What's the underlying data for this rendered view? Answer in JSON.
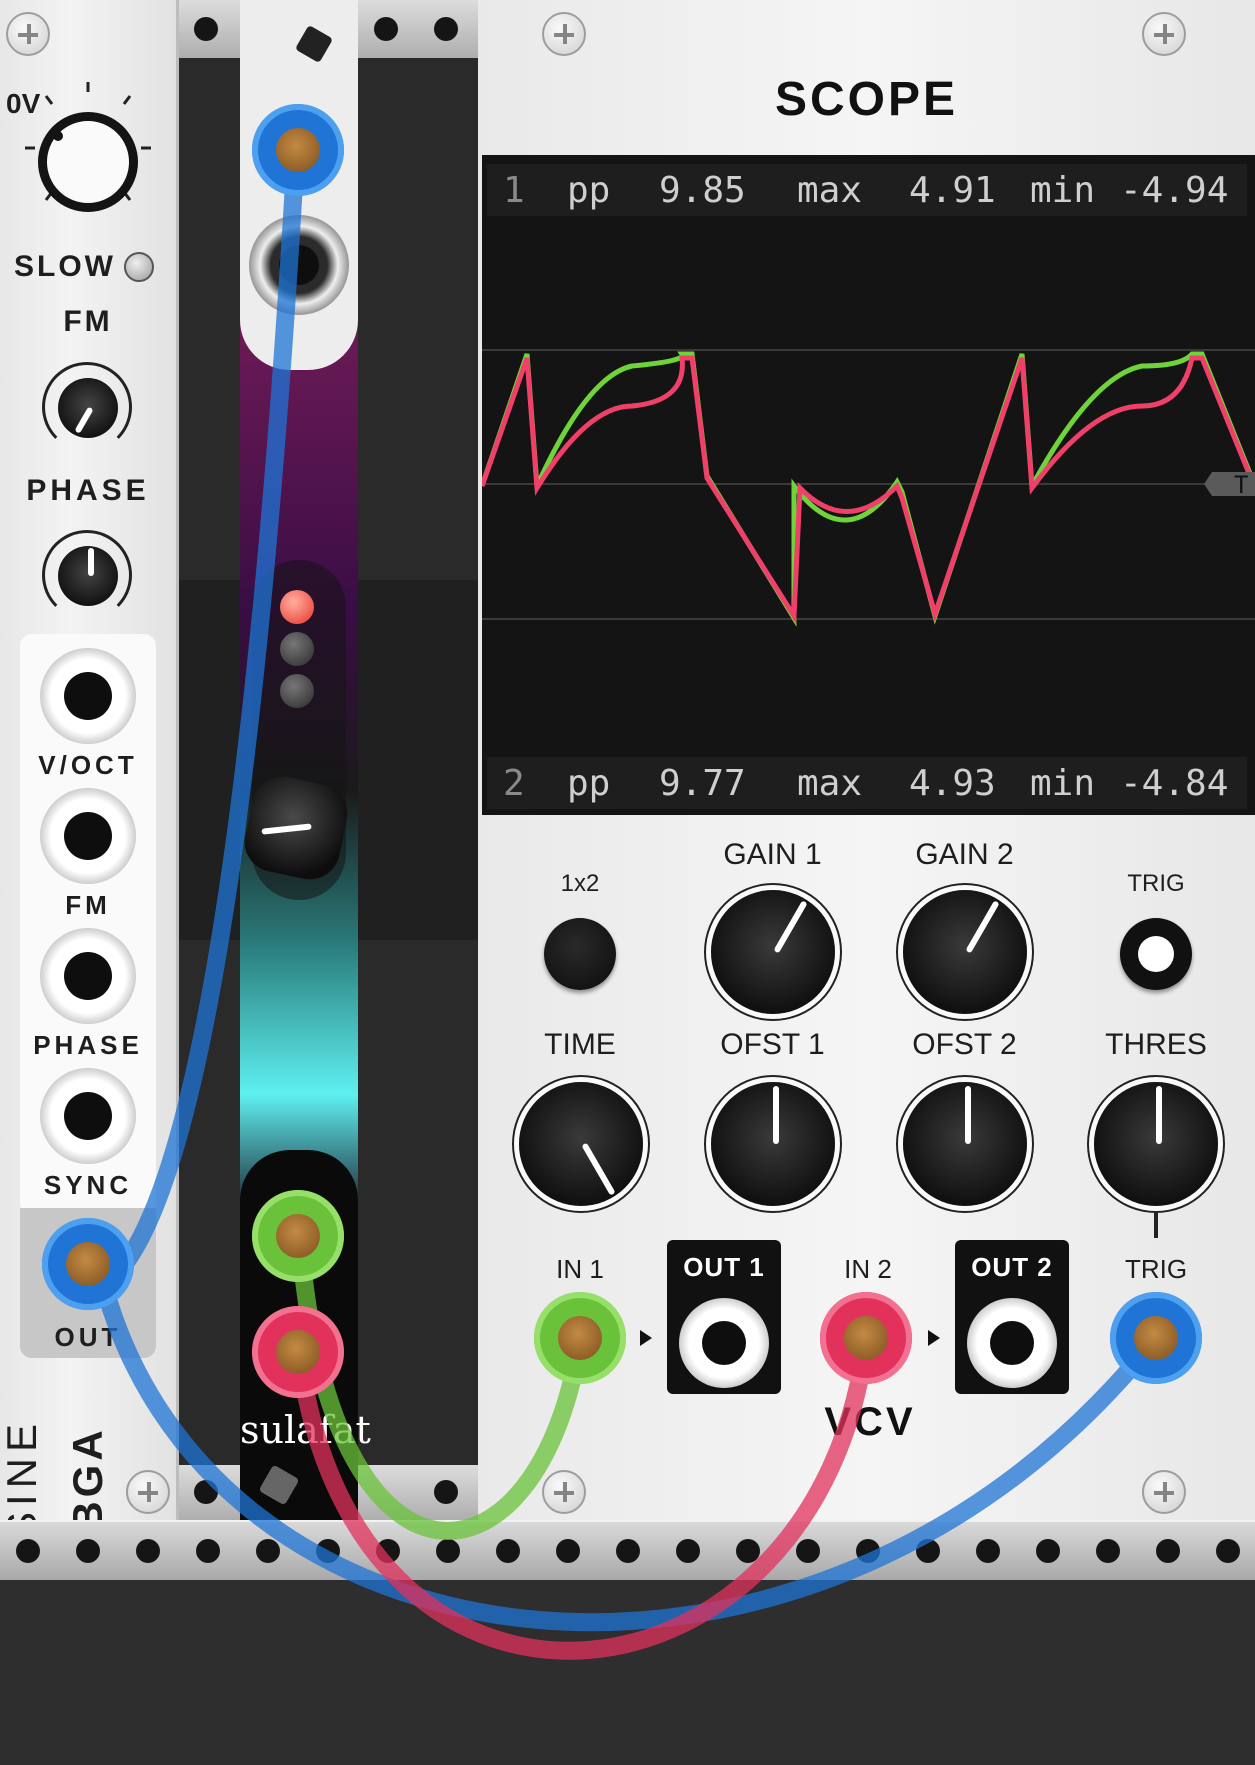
{
  "sine_module": {
    "name": "SINE",
    "brand": "BGA",
    "offset_label": "0V",
    "slow_label": "SLOW",
    "fm_label": "FM",
    "phase_label": "PHASE",
    "inputs": [
      "V/OCT",
      "FM",
      "PHASE",
      "SYNC"
    ],
    "output_label": "OUT"
  },
  "sulafat_module": {
    "name": "sulafat"
  },
  "scope_module": {
    "title": "SCOPE",
    "channel1": {
      "id": "1",
      "pp_label": "pp",
      "pp": "9.85",
      "max_label": "max",
      "max": "4.91",
      "min_label": "min",
      "min": "-4.94"
    },
    "channel2": {
      "id": "2",
      "pp_label": "pp",
      "pp": "9.77",
      "max_label": "max",
      "max": "4.93",
      "min_label": "min",
      "min": "-4.84"
    },
    "trigger_marker": "T",
    "controls": {
      "mode_label": "1x2",
      "gain1_label": "GAIN 1",
      "gain2_label": "GAIN 2",
      "trig_label": "TRIG",
      "time_label": "TIME",
      "ofst1_label": "OFST 1",
      "ofst2_label": "OFST 2",
      "thres_label": "THRES"
    },
    "ports": {
      "in1_label": "IN 1",
      "out1_label": "OUT 1",
      "in2_label": "IN 2",
      "out2_label": "OUT 2",
      "trig_label": "TRIG"
    },
    "brand": "VCV"
  },
  "colors": {
    "cable_blue": "#1f74d6",
    "cable_green": "#6ac23a",
    "cable_red": "#e2325c",
    "trace_green": "#6fd43a",
    "trace_red": "#f0406a"
  }
}
